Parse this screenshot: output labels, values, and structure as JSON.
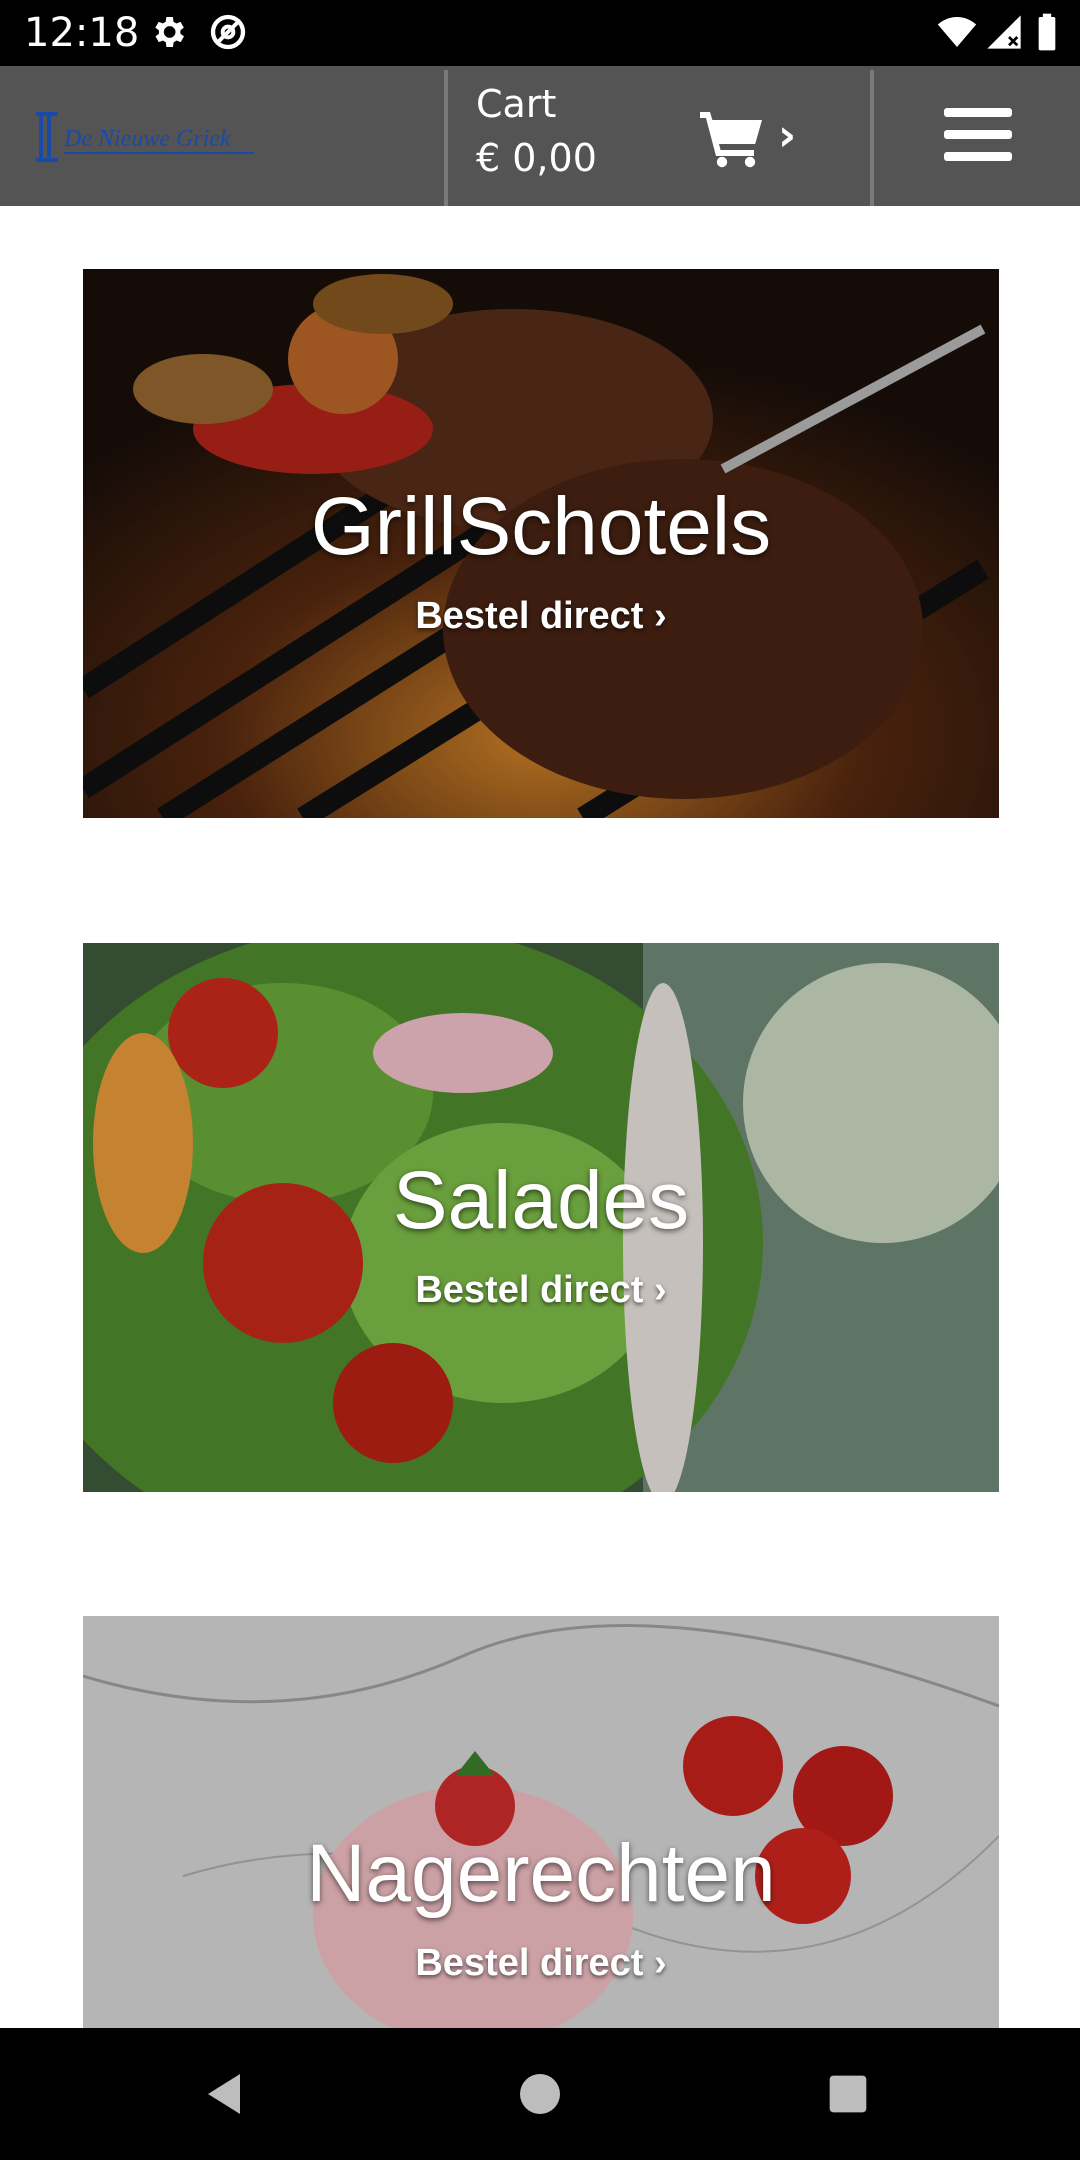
{
  "status_bar": {
    "time": "12:18",
    "icons": [
      "settings-icon",
      "at-sign-icon",
      "wifi-icon",
      "signal-icon",
      "battery-icon"
    ]
  },
  "header": {
    "logo_text": "De Nieuwe Griek",
    "cart_label": "Cart",
    "cart_amount": "€ 0,00",
    "cart_chevron": "›",
    "menu_icon": "hamburger-menu-icon"
  },
  "categories": [
    {
      "title": "GrillSchotels",
      "cta": "Bestel direct ›"
    },
    {
      "title": "Salades",
      "cta": "Bestel direct ›"
    },
    {
      "title": "Nagerechten",
      "cta": "Bestel direct ›"
    }
  ],
  "nav_bar": {
    "icons": [
      "back-icon",
      "home-icon",
      "recents-icon"
    ]
  },
  "colors": {
    "header_bg": "#545454",
    "logo_blue": "#1a4aa8",
    "status_bg": "#000000"
  }
}
